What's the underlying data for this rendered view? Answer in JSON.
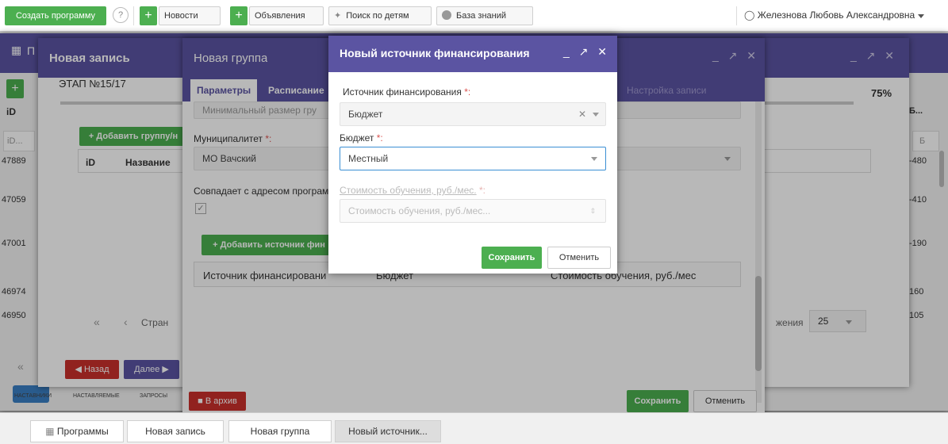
{
  "topbar": {
    "create_program": "Создать программу",
    "help": "?",
    "plus": "+",
    "news": "Новости",
    "ads": "Объявления",
    "child_search": "Поиск по детям",
    "knowledge_base": "База знаний",
    "user": "Железнова Любовь Александровна"
  },
  "left_table": {
    "tab_short": "П",
    "col_id": "iD",
    "filter_id": "iD...",
    "ids": [
      "47889",
      "47059",
      "47001",
      "46974",
      "46950"
    ]
  },
  "right_table": {
    "col_b": "Б...",
    "filter_b": "Б",
    "values": [
      "-480",
      "-410",
      "-190",
      "160",
      "105"
    ]
  },
  "bottom_nav": {
    "mentors": "НАСТАВНИКИ",
    "mentees": "НАСТАВЛЯЕМЫЕ",
    "requests": "ЗАПРОСЫ"
  },
  "win_record": {
    "title": "Новая запись",
    "stage": "ЭТАП №15/17",
    "progress": "75%",
    "add_group": "Добавить группу/н",
    "col_id": "iD",
    "col_name": "Название",
    "pager_prefix": "Стран",
    "pager_suffix": "жения",
    "page_size": "25",
    "back": "Назад",
    "next": "Далее",
    "settings_tab": "Настройка записи"
  },
  "win_group": {
    "title": "Новая группа",
    "tab_params": "Параметры",
    "tab_schedule": "Расписание",
    "min_size": "Минимальный размер гру",
    "municipality_label": "Муниципалитет",
    "municipality_value": "МО Вачский",
    "same_address": "Совпадает с адресом програм",
    "add_funding": "Добавить источник фин",
    "col_source": "Источник финансировани",
    "col_budget": "Бюджет",
    "col_cost": "Стоимость обучения, руб./мес",
    "archive": "В архив",
    "save": "Сохранить",
    "cancel": "Отменить"
  },
  "dialog": {
    "title": "Новый источник финансирования",
    "source_label": "Источник финансирования",
    "source_value": "Бюджет",
    "budget_label": "Бюджет",
    "budget_value": "Местный",
    "cost_label": "Стоимость обучения, руб./мес.",
    "cost_placeholder": "Стоимость обучения, руб./мес...",
    "req": "*:",
    "save": "Сохранить",
    "cancel": "Отменить"
  },
  "taskbar": {
    "programs": "Программы",
    "new_record": "Новая запись",
    "new_group": "Новая группа",
    "new_source": "Новый источник..."
  },
  "colors": {
    "header": "#5b54a2",
    "green": "#4caf50",
    "red": "#c9302c",
    "focus": "#3b8fd4"
  }
}
